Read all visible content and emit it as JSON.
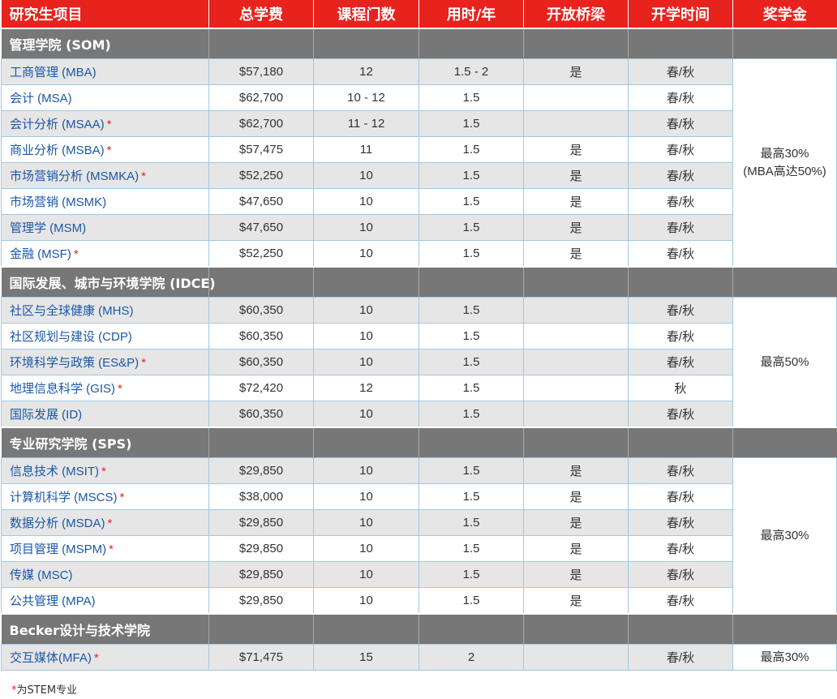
{
  "headers": [
    "研究生项目",
    "总学费",
    "课程门数",
    "用时/年",
    "开放桥梁",
    "开学时间",
    "奖学金"
  ],
  "sections": [
    {
      "title": "管理学院 (SOM)",
      "scholarship": [
        "最高30%",
        "(MBA高达50%)"
      ],
      "rows": [
        {
          "name": "工商管理 (MBA)",
          "star": "",
          "tuition": "$57,180",
          "courses": "12",
          "years": "1.5 - 2",
          "bridge": "是",
          "start": "春/秋"
        },
        {
          "name": "会计 (MSA)",
          "star": "",
          "tuition": "$62,700",
          "courses": "10 - 12",
          "years": "1.5",
          "bridge": "",
          "start": "春/秋"
        },
        {
          "name": "会计分析 (MSAA)",
          "star": "*",
          "tuition": "$62,700",
          "courses": "11 - 12",
          "years": "1.5",
          "bridge": "",
          "start": "春/秋"
        },
        {
          "name": "商业分析 (MSBA)",
          "star": "*",
          "tuition": "$57,475",
          "courses": "11",
          "years": "1.5",
          "bridge": "是",
          "start": "春/秋"
        },
        {
          "name": "市场营销分析 (MSMKA)",
          "star": "*",
          "tuition": "$52,250",
          "courses": "10",
          "years": "1.5",
          "bridge": "是",
          "start": "春/秋"
        },
        {
          "name": "市场营销 (MSMK)",
          "star": "",
          "tuition": "$47,650",
          "courses": "10",
          "years": "1.5",
          "bridge": "是",
          "start": "春/秋"
        },
        {
          "name": "管理学 (MSM)",
          "star": "",
          "tuition": "$47,650",
          "courses": "10",
          "years": "1.5",
          "bridge": "是",
          "start": "春/秋"
        },
        {
          "name": "金融 (MSF)",
          "star": "*",
          "tuition": "$52,250",
          "courses": "10",
          "years": "1.5",
          "bridge": "是",
          "start": "春/秋"
        }
      ]
    },
    {
      "title": "国际发展、城市与环境学院 (IDCE)",
      "scholarship": [
        "最高50%"
      ],
      "rows": [
        {
          "name": "社区与全球健康 (MHS)",
          "star": "",
          "tuition": "$60,350",
          "courses": "10",
          "years": "1.5",
          "bridge": "",
          "start": "春/秋"
        },
        {
          "name": "社区规划与建设 (CDP)",
          "star": "",
          "tuition": "$60,350",
          "courses": "10",
          "years": "1.5",
          "bridge": "",
          "start": "春/秋"
        },
        {
          "name": "环境科学与政策 (ES&P)",
          "star": "*",
          "tuition": "$60,350",
          "courses": "10",
          "years": "1.5",
          "bridge": "",
          "start": "春/秋"
        },
        {
          "name": "地理信息科学 (GIS)",
          "star": "*",
          "tuition": "$72,420",
          "courses": "12",
          "years": "1.5",
          "bridge": "",
          "start": "秋"
        },
        {
          "name": "国际发展 (ID)",
          "star": "",
          "tuition": "$60,350",
          "courses": "10",
          "years": "1.5",
          "bridge": "",
          "start": "春/秋"
        }
      ]
    },
    {
      "title": "专业研究学院 (SPS)",
      "scholarship": [
        "最高30%"
      ],
      "rows": [
        {
          "name": "信息技术 (MSIT)",
          "star": "*",
          "tuition": "$29,850",
          "courses": "10",
          "years": "1.5",
          "bridge": "是",
          "start": "春/秋"
        },
        {
          "name": "计算机科学 (MSCS)",
          "star": "*",
          "tuition": "$38,000",
          "courses": "10",
          "years": "1.5",
          "bridge": "是",
          "start": "春/秋"
        },
        {
          "name": "数据分析 (MSDA)",
          "star": "*",
          "tuition": "$29,850",
          "courses": "10",
          "years": "1.5",
          "bridge": "是",
          "start": "春/秋"
        },
        {
          "name": "项目管理 (MSPM)",
          "star": "*",
          "tuition": "$29,850",
          "courses": "10",
          "years": "1.5",
          "bridge": "是",
          "start": "春/秋"
        },
        {
          "name": "传媒 (MSC)",
          "star": "",
          "tuition": "$29,850",
          "courses": "10",
          "years": "1.5",
          "bridge": "是",
          "start": "春/秋"
        },
        {
          "name": "公共管理 (MPA)",
          "star": "",
          "tuition": "$29,850",
          "courses": "10",
          "years": "1.5",
          "bridge": "是",
          "start": "春/秋"
        }
      ]
    },
    {
      "title": "Becker设计与技术学院",
      "scholarship": [
        "最高30%"
      ],
      "rows": [
        {
          "name": "交互媒体(MFA)",
          "star": "*",
          "tuition": "$71,475",
          "courses": "15",
          "years": "2",
          "bridge": "",
          "start": "春/秋"
        }
      ]
    }
  ],
  "footnote": {
    "star": "*",
    "text": "为STEM专业"
  },
  "colors": {
    "header_bg": "#e8221d",
    "section_bg": "#777777",
    "row_alt_bg": "#e6e6e6",
    "link": "#1a57a8",
    "border": "#9ec9e6"
  }
}
